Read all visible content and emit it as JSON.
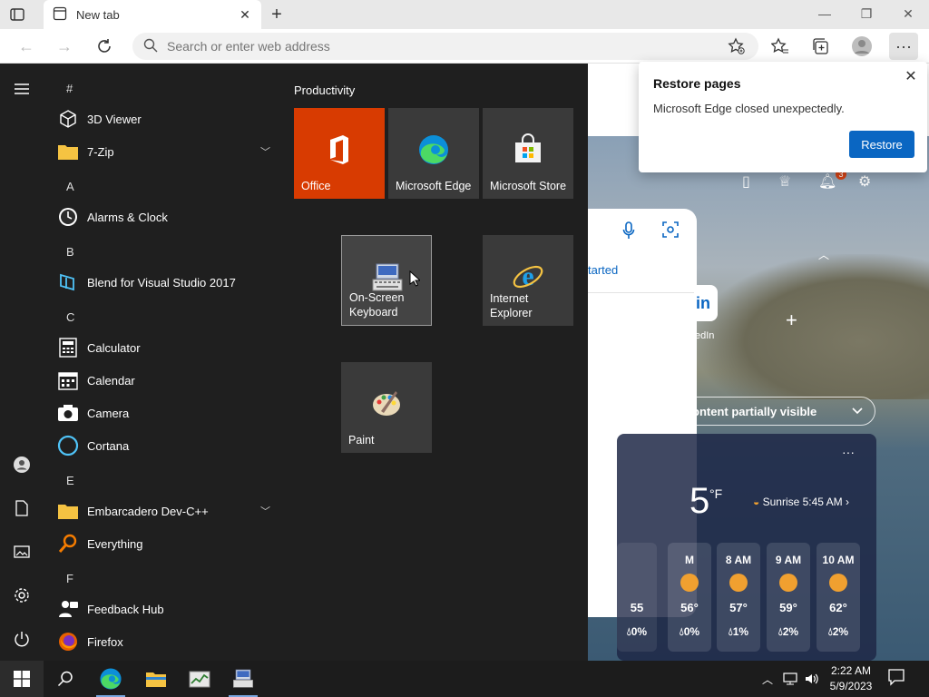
{
  "browser": {
    "tab_title": "New tab",
    "address_placeholder": "Search or enter web address",
    "accent": "#0a66c2"
  },
  "restore_popup": {
    "title": "Restore pages",
    "message": "Microsoft Edge closed unexpectedly.",
    "button": "Restore"
  },
  "ntp": {
    "started_text": "tarted",
    "linkedin_label": "edIn",
    "partial_text": "ontent partially visible",
    "weather": {
      "big_temp": "5",
      "unit": "°F",
      "sunrise": "Sunrise 5:45 AM",
      "hours": [
        {
          "label": "M",
          "temp": "56°",
          "precip": "0%"
        },
        {
          "label": "8 AM",
          "temp": "57°",
          "precip": "1%"
        },
        {
          "label": "9 AM",
          "temp": "59°",
          "precip": "2%"
        },
        {
          "label": "10 AM",
          "temp": "62°",
          "precip": "2%"
        }
      ],
      "partial_hour": {
        "temp": "55",
        "precip": "0%"
      }
    },
    "notification_count": "3"
  },
  "start_menu": {
    "group_title": "Productivity",
    "letters": [
      "#",
      "A",
      "B",
      "C",
      "E",
      "F"
    ],
    "apps": [
      {
        "label": "3D Viewer"
      },
      {
        "label": "7-Zip"
      },
      {
        "label": "Alarms & Clock"
      },
      {
        "label": "Blend for Visual Studio 2017"
      },
      {
        "label": "Calculator"
      },
      {
        "label": "Calendar"
      },
      {
        "label": "Camera"
      },
      {
        "label": "Cortana"
      },
      {
        "label": "Embarcadero Dev-C++"
      },
      {
        "label": "Everything"
      },
      {
        "label": "Feedback Hub"
      },
      {
        "label": "Firefox"
      }
    ],
    "tiles": [
      {
        "label": "Office",
        "color": "#d83b01"
      },
      {
        "label": "Microsoft Edge"
      },
      {
        "label": "Microsoft Store"
      },
      {
        "label_line1": "On-Screen",
        "label_line2": "Keyboard"
      },
      {
        "label_line1": "Internet",
        "label_line2": "Explorer"
      },
      {
        "label": "Paint"
      }
    ]
  },
  "taskbar": {
    "time": "2:22 AM",
    "date": "5/9/2023"
  }
}
